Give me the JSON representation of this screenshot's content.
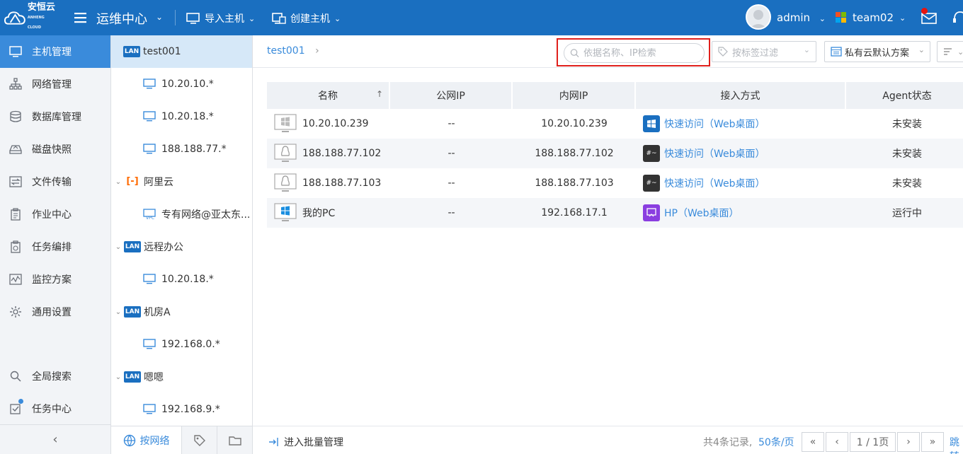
{
  "topbar": {
    "logo_text": "安恒云",
    "logo_sub": "ANHENG CLOUD",
    "title": "运维中心",
    "import_label": "导入主机",
    "create_label": "创建主机",
    "user_name": "admin",
    "team_name": "team02"
  },
  "leftnav": {
    "items": [
      {
        "label": "主机管理",
        "icon": "monitor-icon",
        "active": true
      },
      {
        "label": "网络管理",
        "icon": "network-icon"
      },
      {
        "label": "数据库管理",
        "icon": "database-icon"
      },
      {
        "label": "磁盘快照",
        "icon": "disk-icon"
      },
      {
        "label": "文件传输",
        "icon": "transfer-icon"
      },
      {
        "label": "作业中心",
        "icon": "clipboard-icon"
      },
      {
        "label": "任务编排",
        "icon": "schedule-icon"
      },
      {
        "label": "监控方案",
        "icon": "monitor-chart-icon"
      },
      {
        "label": "通用设置",
        "icon": "gear-icon"
      }
    ],
    "search_label": "全局搜索",
    "task_label": "任务中心"
  },
  "tree": {
    "nodes": [
      {
        "label": "test001",
        "kind": "lan",
        "selected": true
      },
      {
        "label": "10.20.10.*",
        "kind": "subnet"
      },
      {
        "label": "10.20.18.*",
        "kind": "subnet"
      },
      {
        "label": "188.188.77.*",
        "kind": "subnet"
      },
      {
        "label": "阿里云",
        "kind": "aliyun"
      },
      {
        "label": "专有网络@亚太东...",
        "kind": "vpc"
      },
      {
        "label": "远程办公",
        "kind": "lan"
      },
      {
        "label": "10.20.18.*",
        "kind": "subnet"
      },
      {
        "label": "机房A",
        "kind": "lan"
      },
      {
        "label": "192.168.0.*",
        "kind": "subnet"
      },
      {
        "label": "嗯嗯",
        "kind": "lan"
      },
      {
        "label": "192.168.9.*",
        "kind": "subnet"
      }
    ],
    "lan_badge": "LAN",
    "bottom_tab": "按网络"
  },
  "main": {
    "breadcrumb": "test001",
    "search_placeholder": "依据名称、IP检索",
    "tag_filter_placeholder": "按标签过滤",
    "plan_select": "私有云默认方案",
    "columns": [
      "名称",
      "公网IP",
      "内网IP",
      "接入方式",
      "Agent状态"
    ],
    "rows": [
      {
        "name": "10.20.10.239",
        "os": "windows-grey",
        "public_ip": "--",
        "private_ip": "10.20.10.239",
        "access": "快速访问（Web桌面）",
        "access_icon": "windows-blue",
        "agent": "未安装"
      },
      {
        "name": "188.188.77.102",
        "os": "linux",
        "public_ip": "--",
        "private_ip": "188.188.77.102",
        "access": "快速访问（Web桌面）",
        "access_icon": "terminal",
        "agent": "未安装"
      },
      {
        "name": "188.188.77.103",
        "os": "linux",
        "public_ip": "--",
        "private_ip": "188.188.77.103",
        "access": "快速访问（Web桌面）",
        "access_icon": "terminal",
        "agent": "未安装"
      },
      {
        "name": "我的PC",
        "os": "windows-blue",
        "public_ip": "--",
        "private_ip": "192.168.17.1",
        "access": "HP（Web桌面）",
        "access_icon": "remote-purple",
        "agent": "运行中"
      }
    ],
    "footer": {
      "batch_label": "进入批量管理",
      "total": "共4条记录,",
      "per_page": "50条/页",
      "page": "1 / 1页",
      "jump": "跳转"
    }
  },
  "colors": {
    "topbar": "#1a6fc0",
    "accent": "#3a8bdb",
    "highlight_border": "#e0201c"
  }
}
